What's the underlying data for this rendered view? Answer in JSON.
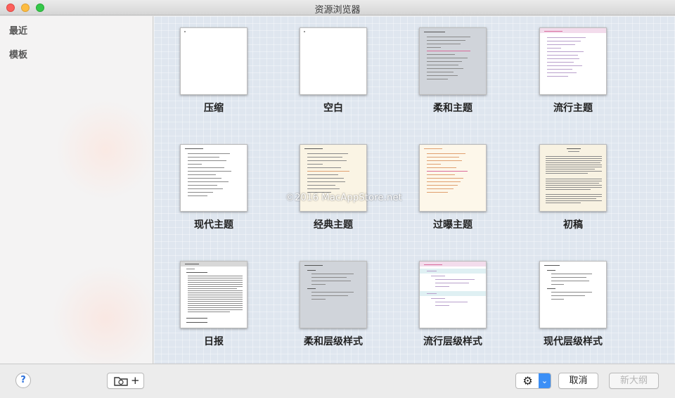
{
  "window": {
    "title": "资源浏览器"
  },
  "sidebar": {
    "items": [
      {
        "label": "最近"
      },
      {
        "label": "模板"
      }
    ]
  },
  "templates": [
    {
      "label": "压缩",
      "style": "blank"
    },
    {
      "label": "空白",
      "style": "blank"
    },
    {
      "label": "柔和主题",
      "style": "gray"
    },
    {
      "label": "流行主题",
      "style": "pink"
    },
    {
      "label": "现代主题",
      "style": "white"
    },
    {
      "label": "经典主题",
      "style": "cream"
    },
    {
      "label": "过曝主题",
      "style": "peach"
    },
    {
      "label": "初稿",
      "style": "parch"
    },
    {
      "label": "日报",
      "style": "report"
    },
    {
      "label": "柔和层级样式",
      "style": "gray"
    },
    {
      "label": "流行层级样式",
      "style": "pink"
    },
    {
      "label": "现代层级样式",
      "style": "white"
    }
  ],
  "watermark": "©2016 MacAppStore.net",
  "bottom": {
    "help_label": "?",
    "add_icon_label": "+",
    "cancel_label": "取消",
    "new_outline_label": "新大纲",
    "gear_glyph": "⚙",
    "chevron_glyph": "⌄"
  }
}
